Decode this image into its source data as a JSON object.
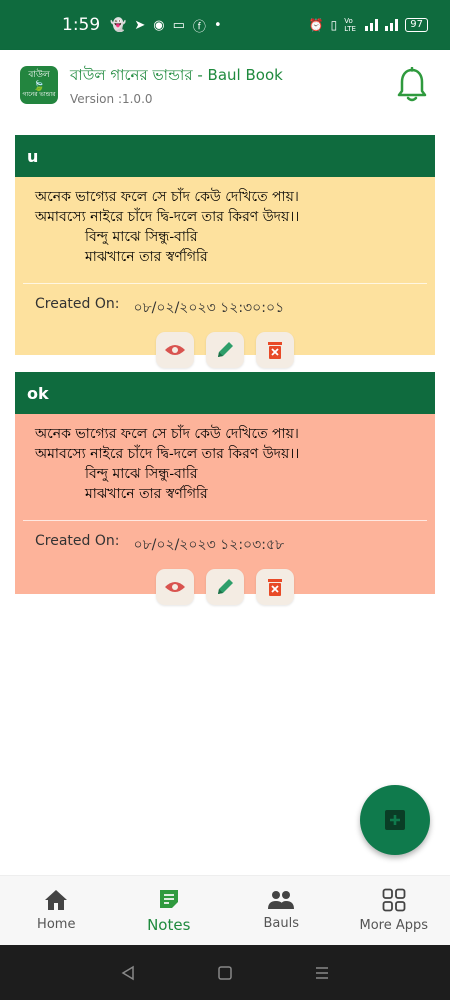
{
  "status_bar": {
    "time": "1:59",
    "volte": "Vo LTE",
    "battery": "97"
  },
  "header": {
    "logo_text_top": "বাউল",
    "logo_text_bottom": "গানের ভান্ডার",
    "title": "বাউল গানের ভান্ডার - Baul Book",
    "version": "Version :1.0.0"
  },
  "notes": [
    {
      "title": "u",
      "lines": [
        "অনেক ভাগ্যের ফলে সে চাঁদ কেউ দেখিতে পায়।",
        "অমাবস্যে নাইরে চাঁদে দ্বি-দলে তার কিরণ উদয়।।"
      ],
      "indented_lines": [
        "বিন্দু মাঝে সিন্ধু-বারি",
        "মাঝখানে তার স্বর্ণগিরি"
      ],
      "created_label": "Created On:",
      "created_value": "০৮/০২/২০২৩ ১২:৩০:০১",
      "bg_color": "#fde19e"
    },
    {
      "title": "ok",
      "lines": [
        "অনেক ভাগ্যের ফলে সে চাঁদ কেউ দেখিতে পায়।",
        "অমাবস্যে নাইরে চাঁদে দ্বি-দলে তার কিরণ উদয়।।"
      ],
      "indented_lines": [
        "বিন্দু মাঝে সিন্ধু-বারি",
        "মাঝখানে তার স্বর্ণগিরি"
      ],
      "created_label": "Created On:",
      "created_value": "০৮/০২/২০২৩ ১২:০৩:৫৮",
      "bg_color": "#fdb39a"
    }
  ],
  "bottom_nav": [
    {
      "label": "Home",
      "icon": "home-icon"
    },
    {
      "label": "Notes",
      "icon": "notes-icon",
      "active": true
    },
    {
      "label": "Bauls",
      "icon": "people-icon"
    },
    {
      "label": "More Apps",
      "icon": "grid-icon"
    }
  ],
  "colors": {
    "primary": "#0f6b3e",
    "accent_green": "#1f8a3e",
    "fab": "#0f7a4c"
  }
}
